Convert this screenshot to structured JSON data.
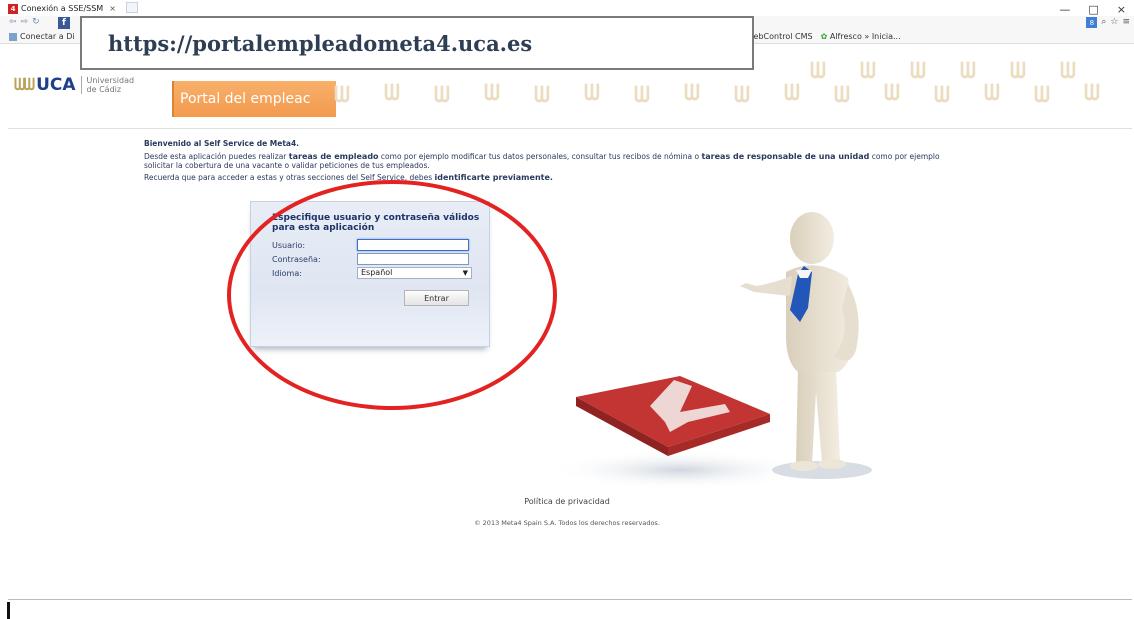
{
  "browser": {
    "tab_title": "Conexión a SSE/SSM",
    "tab_close": "×",
    "favicon_label": "4",
    "url": "https://portalempleadometa4.uca.es",
    "bookmarks": {
      "left": "Conectar a Di",
      "right": [
        "webControl CMS",
        "Alfresco » Inicia..."
      ]
    },
    "window_buttons": [
      "—",
      "□",
      "×"
    ]
  },
  "header": {
    "logo_text": "UCA",
    "logo_subtitle_line1": "Universidad",
    "logo_subtitle_line2": "de Cádiz",
    "portal_title": "Portal del empleac"
  },
  "intro": {
    "welcome": "Bienvenido al Self Service de Meta4.",
    "line1_a": "Desde esta aplicación puedes realizar ",
    "line1_b": "tareas de empleado",
    "line1_c": " como por ejemplo modificar tus datos personales, consultar tus recibos de nómina o ",
    "line1_d": "tareas de responsable de una unidad",
    "line1_e": " como por ejemplo",
    "line2": "solicitar la cobertura de una vacante o validar peticiones de tus empleados.",
    "line3_a": "Recuerda que para acceder a estas y otras secciones del Self Service, debes ",
    "line3_b": "identificarte previamente."
  },
  "login": {
    "title": "Especifique usuario y contraseña válidos para esta aplicación",
    "user_label": "Usuario:",
    "user_value": "",
    "password_label": "Contraseña:",
    "password_value": "",
    "language_label": "Idioma:",
    "language_value": "Español",
    "submit_label": "Entrar"
  },
  "footer": {
    "privacy": "Política de privacidad",
    "copyright": "© 2013 Meta4 Spain S.A. Todos los derechos reservados."
  },
  "colors": {
    "accent_orange": "#f39a4f",
    "highlight_red": "#e32222",
    "text_navy": "#283a5e"
  }
}
